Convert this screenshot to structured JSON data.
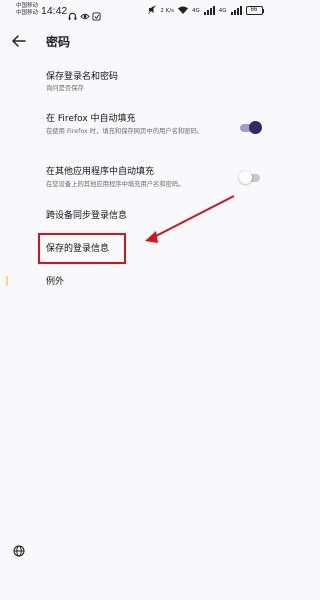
{
  "status_bar": {
    "carrier_line1": "中国移动",
    "carrier_line2": "中国移动",
    "time": "14:42",
    "speed": "2 K/s",
    "network_label1": "4G",
    "network_label2": "4G",
    "battery": "66"
  },
  "header": {
    "title": "密码"
  },
  "settings": {
    "save_logins": {
      "title": "保存登录名和密码",
      "summary": "询问是否保存"
    },
    "autofill_firefox": {
      "title": "在 Firefox 中自动填充",
      "summary": "在使用 Firefox 时，填充和保存网页中的用户名和密码。",
      "enabled": true
    },
    "autofill_other_apps": {
      "title": "在其他应用程序中自动填充",
      "summary": "在您设备上的其他应用程序中填充用户名和密码。",
      "enabled": false
    },
    "sync_logins": {
      "title": "跨设备同步登录信息"
    },
    "saved_logins": {
      "title": "保存的登录信息"
    },
    "exceptions": {
      "title": "例外"
    }
  },
  "colors": {
    "accent_toggle_on": "#312a65",
    "annotation_red": "#d4141c",
    "background": "#f9f9fb"
  }
}
